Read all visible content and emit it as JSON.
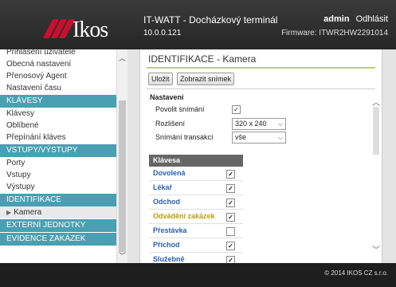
{
  "header": {
    "brand": "Ikos",
    "title": "IT-WATT - Docházkový terminál",
    "ip": "10.0.0.121",
    "user": "admin",
    "logout": "Odhlásit",
    "firmware": "Firmware: ITWR2HW2291014"
  },
  "sidebar": {
    "items": [
      {
        "label": "Přihlášení uživatele",
        "type": "item"
      },
      {
        "label": "Obecná nastavení",
        "type": "item"
      },
      {
        "label": "Přenosový Agent",
        "type": "item"
      },
      {
        "label": "Nastavení času",
        "type": "item"
      },
      {
        "label": "KLÁVESY",
        "type": "group"
      },
      {
        "label": "Klávesy",
        "type": "item"
      },
      {
        "label": "Oblíbené",
        "type": "item"
      },
      {
        "label": "Přepínání kláves",
        "type": "item"
      },
      {
        "label": "VSTUPY/VÝSTUPY",
        "type": "group"
      },
      {
        "label": "Porty",
        "type": "item"
      },
      {
        "label": "Vstupy",
        "type": "item"
      },
      {
        "label": "Výstupy",
        "type": "item"
      },
      {
        "label": "IDENTIFIKACE",
        "type": "group"
      },
      {
        "label": "Kamera",
        "type": "active"
      },
      {
        "label": "EXTERNÍ JEDNOTKY",
        "type": "group"
      },
      {
        "label": "EVIDENCE ZAKÁZEK",
        "type": "group"
      }
    ]
  },
  "main": {
    "title": "IDENTIFIKACE - Kamera",
    "buttons": {
      "save": "Uložit",
      "show": "Zobrazit snímek"
    },
    "section": "Nastavení",
    "fields": {
      "enable_label": "Povolit snímání",
      "enable_checked": "✓",
      "resolution_label": "Rozlišení",
      "resolution_value": "320 x 240",
      "trans_label": "Snímání transakcí",
      "trans_value": "vše"
    },
    "table": {
      "header": "Klávesa",
      "rows": [
        {
          "label": "Dovolená",
          "color": "#2a5fb0",
          "checked": "✓"
        },
        {
          "label": "Lékař",
          "color": "#2a5fb0",
          "checked": "✓"
        },
        {
          "label": "Odchod",
          "color": "#2a5fb0",
          "checked": "✓"
        },
        {
          "label": "Odvádění zakázek",
          "color": "#b8a000",
          "checked": "✓"
        },
        {
          "label": "Přestávka",
          "color": "#2a5fb0",
          "checked": ""
        },
        {
          "label": "Příchod",
          "color": "#2a5fb0",
          "checked": "✓"
        },
        {
          "label": "Služebně",
          "color": "#2a5fb0",
          "checked": "✓"
        }
      ]
    }
  },
  "footer": {
    "copyright": "© 2014 IKOS CZ s.r.o."
  }
}
